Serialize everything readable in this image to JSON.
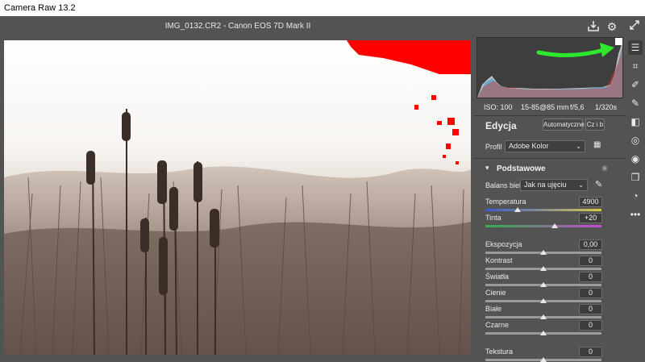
{
  "window": {
    "title": "Camera Raw 13.2"
  },
  "topbar": {
    "filename": "IMG_0132.CR2  -  Canon EOS 7D Mark II"
  },
  "camera_info": {
    "iso": "ISO: 100",
    "lens": "15-85@85 mm",
    "aperture": "f/5,6",
    "shutter": "1/320s"
  },
  "edit_panel": {
    "title": "Edycja",
    "auto_button": "Automatyczne",
    "bw_button": "Cz i b",
    "profile_label": "Profil",
    "profile_value": "Adobe Kolor",
    "section_basic": "Podstawowe",
    "white_balance_label": "Balans bieli",
    "white_balance_value": "Jak na ujęciu"
  },
  "sliders": [
    {
      "label": "Temperatura",
      "value": "4900",
      "position": 0.28
    },
    {
      "label": "Tinta",
      "value": "+20",
      "position": 0.6
    },
    {
      "label": "Ekspozycja",
      "value": "0,00",
      "position": 0.5
    },
    {
      "label": "Kontrast",
      "value": "0",
      "position": 0.5
    },
    {
      "label": "Światła",
      "value": "0",
      "position": 0.5
    },
    {
      "label": "Cienie",
      "value": "0",
      "position": 0.5
    },
    {
      "label": "Białe",
      "value": "0",
      "position": 0.5
    },
    {
      "label": "Czarne",
      "value": "0",
      "position": 0.5
    },
    {
      "label": "Tekstura",
      "value": "0",
      "position": 0.5
    }
  ],
  "colors": {
    "highlight_clipping": "#ff0000",
    "annotation_arrow": "#2ee82e",
    "temperature_gradient": [
      "#3a5ad0",
      "#d8c84a"
    ],
    "tint_gradient": [
      "#2fae4a",
      "#c44ad0"
    ]
  },
  "toolbar": {
    "tools": [
      "edit-icon",
      "crop-icon",
      "healing-icon",
      "brush-icon",
      "gradient-icon",
      "radial-icon",
      "redeye-icon",
      "snapshots-icon",
      "presets-icon",
      "more-icon"
    ]
  }
}
